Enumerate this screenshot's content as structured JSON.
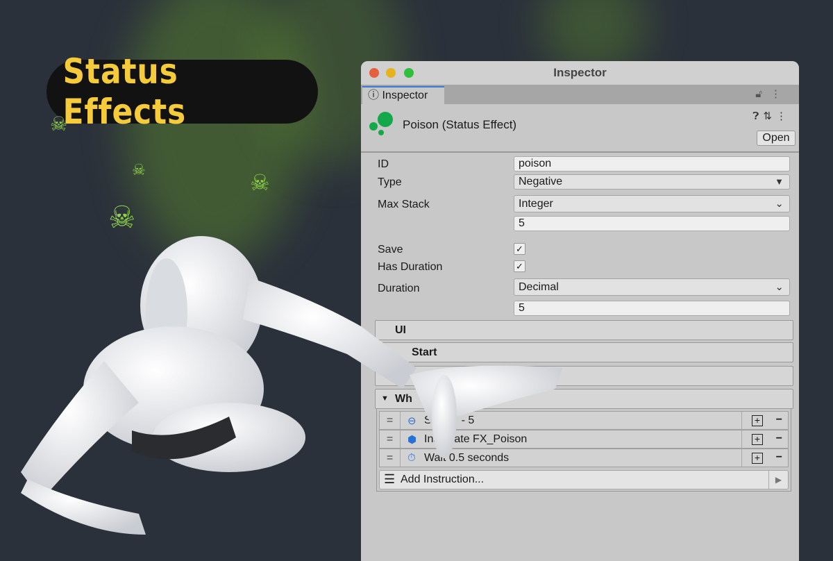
{
  "banner": {
    "title": "Status Effects",
    "title_color": "#f5cb3c"
  },
  "window": {
    "title": "Inspector",
    "tab": "Inspector"
  },
  "header": {
    "name": "Poison (Status Effect)",
    "open_label": "Open",
    "icon_color": "#13a84a"
  },
  "fields": {
    "id_label": "ID",
    "id_value": "poison",
    "type_label": "Type",
    "type_value": "Negative",
    "max_stack_label": "Max Stack",
    "max_stack_mode": "Integer",
    "max_stack_value": "5",
    "save_label": "Save",
    "save_checked": true,
    "has_duration_label": "Has Duration",
    "has_duration_checked": true,
    "duration_label": "Duration",
    "duration_mode": "Decimal",
    "duration_value": "5"
  },
  "sections": {
    "ui": "UI",
    "start": "Start",
    "while": "Wh"
  },
  "instructions": [
    {
      "icon": "toggle-icon",
      "text_a": "Se",
      "text_b": "- 5"
    },
    {
      "icon": "instantiate-icon",
      "text_a": "Inst",
      "text_b": "iate FX_Poison"
    },
    {
      "icon": "stopwatch-icon",
      "text_a": "Wait 0.5 seconds",
      "text_b": ""
    }
  ],
  "add_instruction": "Add Instruction..."
}
